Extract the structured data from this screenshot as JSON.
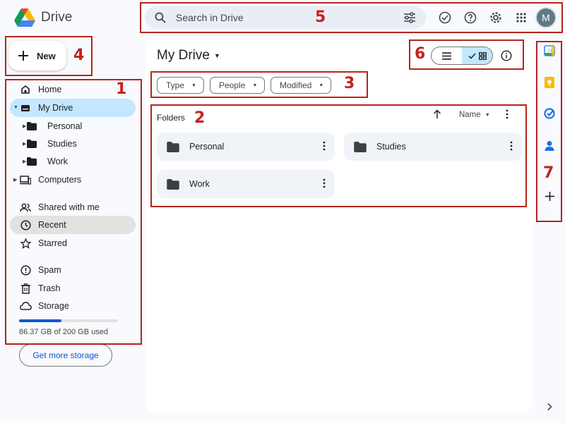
{
  "app": {
    "name": "Drive"
  },
  "search": {
    "placeholder": "Search in Drive"
  },
  "account": {
    "initial": "M"
  },
  "new_button": {
    "label": "New"
  },
  "sidebar": {
    "items": [
      {
        "label": "Home",
        "icon": "home-icon"
      },
      {
        "label": "My Drive",
        "icon": "drive-icon"
      },
      {
        "label": "Personal",
        "icon": "folder-icon"
      },
      {
        "label": "Studies",
        "icon": "folder-icon"
      },
      {
        "label": "Work",
        "icon": "folder-icon"
      },
      {
        "label": "Computers",
        "icon": "computer-icon"
      },
      {
        "label": "Shared with me",
        "icon": "people-icon"
      },
      {
        "label": "Recent",
        "icon": "clock-icon"
      },
      {
        "label": "Starred",
        "icon": "star-icon"
      },
      {
        "label": "Spam",
        "icon": "spam-icon"
      },
      {
        "label": "Trash",
        "icon": "trash-icon"
      },
      {
        "label": "Storage",
        "icon": "cloud-icon"
      }
    ],
    "storage": {
      "used_text": "86.37 GB of 200 GB used",
      "used_fraction": 0.43
    },
    "more_storage_label": "Get more storage"
  },
  "main": {
    "title": "My Drive",
    "filters": [
      "Type",
      "People",
      "Modified"
    ],
    "section_label": "Folders",
    "sort_label": "Name",
    "folders": [
      "Personal",
      "Studies",
      "Work"
    ]
  },
  "annotations": [
    "1",
    "2",
    "3",
    "4",
    "5",
    "6",
    "7"
  ],
  "colors": {
    "accent": "#0b57d0",
    "active_bg": "#c2e7ff",
    "annotation": "#b3261e"
  }
}
